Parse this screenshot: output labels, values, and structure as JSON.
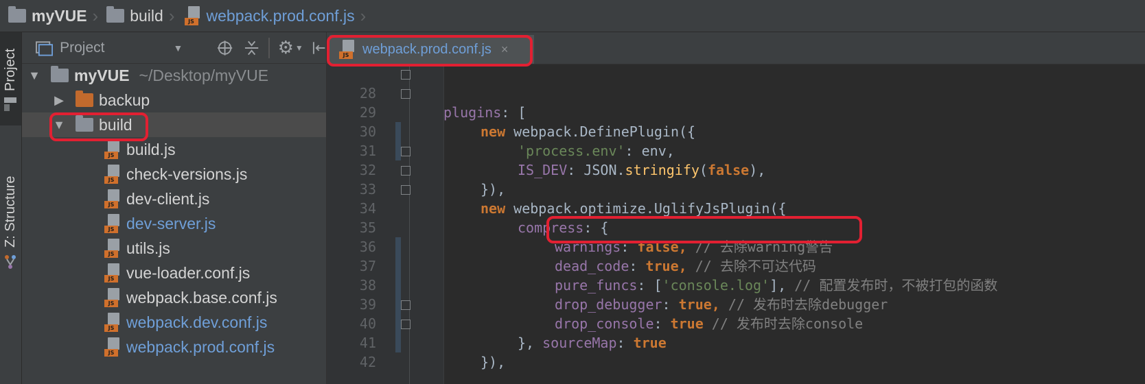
{
  "breadcrumb": {
    "items": [
      {
        "label": "myVUE",
        "icon": "folder-icon"
      },
      {
        "label": "build",
        "icon": "folder-icon"
      },
      {
        "label": "webpack.prod.conf.js",
        "icon": "js-file-icon"
      }
    ]
  },
  "toolstrip": {
    "project_label": "Project",
    "structure_label": "Z: Structure"
  },
  "project_panel": {
    "view_selector": "Project",
    "root": {
      "name": "myVUE",
      "path": "~/Desktop/myVUE"
    },
    "folders": [
      "backup",
      "build"
    ],
    "files": [
      {
        "name": "build.js",
        "modified": false
      },
      {
        "name": "check-versions.js",
        "modified": false
      },
      {
        "name": "dev-client.js",
        "modified": false
      },
      {
        "name": "dev-server.js",
        "modified": true
      },
      {
        "name": "utils.js",
        "modified": false
      },
      {
        "name": "vue-loader.conf.js",
        "modified": false
      },
      {
        "name": "webpack.base.conf.js",
        "modified": false
      },
      {
        "name": "webpack.dev.conf.js",
        "modified": true
      },
      {
        "name": "webpack.prod.conf.js",
        "modified": true
      }
    ]
  },
  "tabs": [
    {
      "label": "webpack.prod.conf.js",
      "close": "×",
      "active": true
    }
  ],
  "editor": {
    "line_numbers": [
      "28",
      "29",
      "30",
      "31",
      "32",
      "33",
      "34",
      "35",
      "36",
      "37",
      "38",
      "39",
      "40",
      "41",
      "42"
    ],
    "lines": {
      "l28": {
        "a": "plugins",
        "b": ": ["
      },
      "l29": {
        "a": "new",
        "b": " webpack.",
        "c": "DefinePlugin",
        "d": "({"
      },
      "l30": {
        "a": "'process.env'",
        "b": ": env,"
      },
      "l31": {
        "a": "IS_DEV",
        "b": ": JSON.",
        "c": "stringify",
        "d": "(",
        "e": "false",
        "f": "),"
      },
      "l32": {
        "a": "}),"
      },
      "l33": {
        "a": "new",
        "b": " webpack.",
        "c": "optimize",
        "d": ".",
        "e": "UglifyJsPlugin",
        "f": "({"
      },
      "l34": {
        "a": "compress",
        "b": ": {"
      },
      "l35": {
        "a": "warnings",
        "b": ": ",
        "c": "false,",
        "d": " // 去除warning警告"
      },
      "l36": {
        "a": "dead_code",
        "b": ": ",
        "c": "true,",
        "d": " // 去除不可达代码"
      },
      "l37": {
        "a": "pure_funcs",
        "b": ": [",
        "c": "'console.log'",
        "d": "],",
        "e": " // 配置发布时，不被打包的函数"
      },
      "l38": {
        "a": "drop_debugger",
        "b": ": ",
        "c": "true,",
        "d": " // 发布时去除debugger"
      },
      "l39": {
        "a": "drop_console",
        "b": ": ",
        "c": "true",
        "d": " // 发布时去除console"
      },
      "l40": {
        "a": "}, ",
        "b": "sourceMap",
        "c": ": ",
        "d": "true"
      },
      "l41": {
        "a": "}),"
      }
    }
  },
  "colors": {
    "keyword": "#cc7832",
    "property": "#9876aa",
    "string": "#6a8759",
    "function": "#ffc66d",
    "comment": "#808080",
    "annotation": "#e22032"
  }
}
